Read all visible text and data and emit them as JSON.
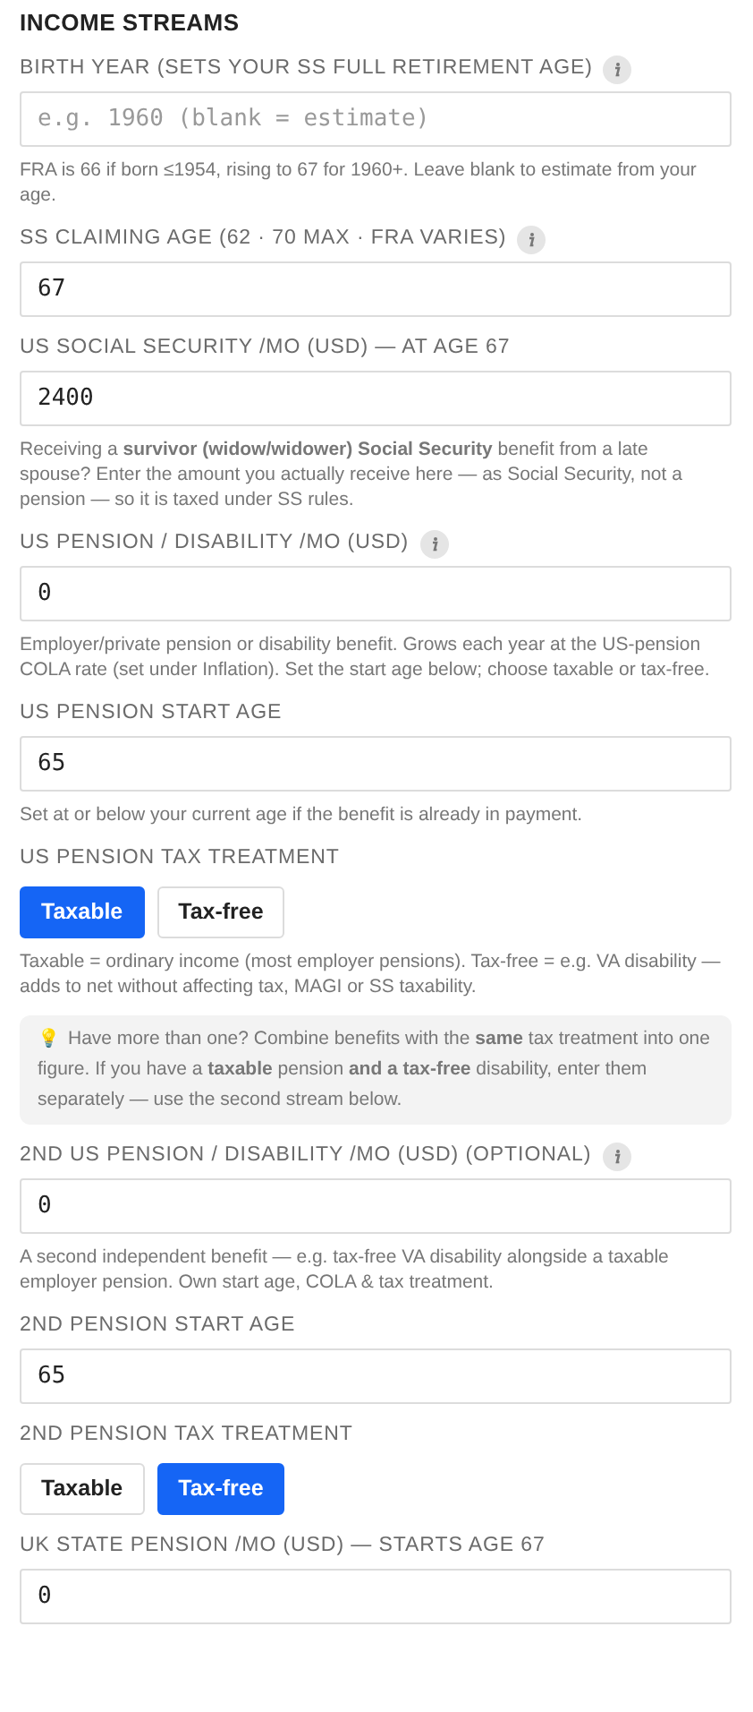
{
  "heading": "INCOME STREAMS",
  "blocks": [
    {
      "kind": "field",
      "label": "BIRTH YEAR (SETS YOUR SS FULL RETIREMENT AGE)",
      "info": true,
      "placeholder": "e.g. 1960 (blank = estimate)"
    },
    {
      "kind": "help",
      "text": "FRA is 66 if born ≤1954, rising to 67 for 1960+. Leave blank to estimate from your age."
    },
    {
      "kind": "field",
      "label": "SS CLAIMING AGE (62 · 70 MAX · FRA VARIES)",
      "info": true,
      "value": "67"
    },
    {
      "kind": "field",
      "label": "US SOCIAL SECURITY /MO (USD) — AT AGE 67",
      "info": false,
      "value": "2400"
    },
    {
      "kind": "help",
      "text": "Receiving a **survivor (widow/widower) Social Security** benefit from a late spouse? Enter the amount you actually receive here — as Social Security, not a pension — so it is taxed under SS rules."
    },
    {
      "kind": "field",
      "label": "US PENSION / DISABILITY /MO (USD)",
      "info": true,
      "value": "0"
    },
    {
      "kind": "help",
      "text": "Employer/private pension or disability benefit. Grows each year at the US-pension COLA rate (set under Inflation). Set the start age below; choose taxable or tax-free."
    },
    {
      "kind": "field",
      "label": "US PENSION START AGE",
      "info": false,
      "value": "65"
    },
    {
      "kind": "help",
      "text": "Set at or below your current age if the benefit is already in payment."
    },
    {
      "kind": "toggle",
      "label": "US PENSION TAX TREATMENT",
      "options": [
        {
          "label": "Taxable",
          "selected": true
        },
        {
          "label": "Tax-free",
          "selected": false
        }
      ]
    },
    {
      "kind": "help",
      "text": "Taxable = ordinary income (most employer pensions). Tax-free = e.g. VA disability — adds to net without affecting tax, MAGI or SS taxability."
    },
    {
      "kind": "tip",
      "icon": "💡",
      "text": "Have more than one? Combine benefits with the **same** tax treatment into one figure. If you have a **taxable** pension **and a tax-free** disability, enter them separately — use the second stream below."
    },
    {
      "kind": "field",
      "label": "2ND US PENSION / DISABILITY /MO (USD) (OPTIONAL)",
      "info": true,
      "value": "0"
    },
    {
      "kind": "help",
      "text": "A second independent benefit — e.g. tax-free VA disability alongside a taxable employer pension. Own start age, COLA & tax treatment."
    },
    {
      "kind": "field",
      "label": "2ND PENSION START AGE",
      "info": false,
      "value": "65"
    },
    {
      "kind": "toggle",
      "label": "2ND PENSION TAX TREATMENT",
      "options": [
        {
          "label": "Taxable",
          "selected": false
        },
        {
          "label": "Tax-free",
          "selected": true
        }
      ]
    },
    {
      "kind": "field",
      "label": "UK STATE PENSION /MO (USD) — STARTS AGE 67",
      "info": false,
      "value": "0"
    }
  ]
}
